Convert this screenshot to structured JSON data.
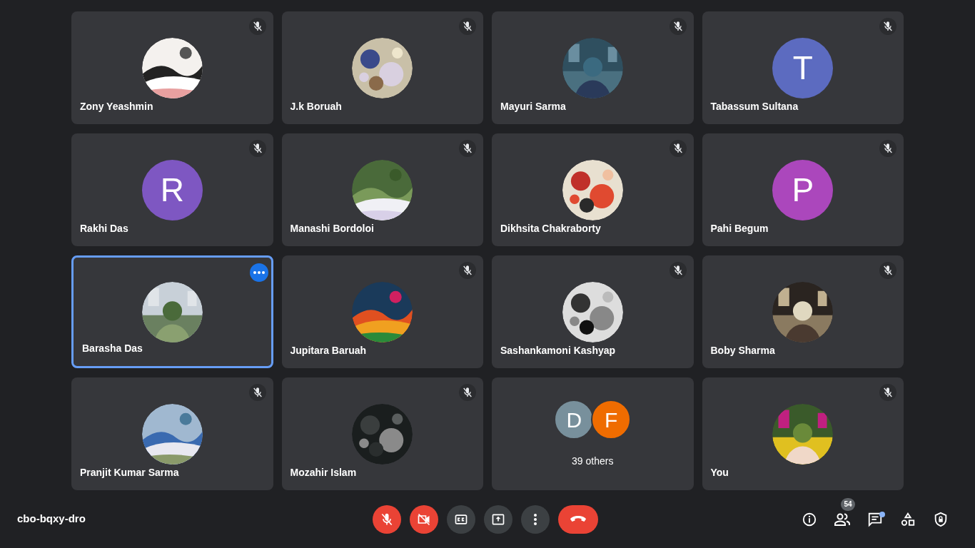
{
  "tiles": [
    {
      "kind": "picture",
      "name": "Zony Yeashmin",
      "muted": true,
      "selected": false
    },
    {
      "kind": "picture",
      "name": "J.k Boruah",
      "muted": true,
      "selected": false
    },
    {
      "kind": "picture",
      "name": "Mayuri Sarma",
      "muted": true,
      "selected": false
    },
    {
      "kind": "letter",
      "letter": "T",
      "color": "#5c6bc0",
      "name": "Tabassum Sultana",
      "muted": true,
      "selected": false
    },
    {
      "kind": "letter",
      "letter": "R",
      "color": "#7e57c2",
      "name": "Rakhi Das",
      "muted": true,
      "selected": false
    },
    {
      "kind": "picture",
      "name": "Manashi Bordoloi",
      "muted": true,
      "selected": false
    },
    {
      "kind": "picture",
      "name": "Dikhsita Chakraborty",
      "muted": true,
      "selected": false
    },
    {
      "kind": "letter",
      "letter": "P",
      "color": "#ab47bc",
      "name": "Pahi Begum",
      "muted": true,
      "selected": false
    },
    {
      "kind": "picture",
      "name": "Barasha Das",
      "selected": true
    },
    {
      "kind": "picture",
      "name": "Jupitara Baruah",
      "muted": true,
      "selected": false
    },
    {
      "kind": "picture",
      "name": "Sashankamoni Kashyap",
      "muted": true,
      "selected": false
    },
    {
      "kind": "picture",
      "name": "Boby Sharma",
      "muted": true,
      "selected": false
    },
    {
      "kind": "picture",
      "name": "Pranjit Kumar Sarma",
      "muted": true,
      "selected": false
    },
    {
      "kind": "picture",
      "name": "Mozahir Islam",
      "muted": true,
      "selected": false
    },
    {
      "kind": "others",
      "avatars": [
        {
          "letter": "D",
          "color": "#78909c"
        },
        {
          "letter": "F",
          "color": "#ef6c00"
        }
      ],
      "label": "39 others"
    },
    {
      "kind": "picture",
      "name": "You",
      "muted": true,
      "selected": false
    }
  ],
  "meeting_code": "cbo-bqxy-dro",
  "controls": [
    {
      "kind": "mic",
      "on": false
    },
    {
      "kind": "camera",
      "on": false
    },
    {
      "kind": "captions",
      "on": false
    },
    {
      "kind": "present",
      "on": false
    },
    {
      "kind": "more",
      "on": false
    },
    {
      "kind": "end_call",
      "on": false
    }
  ],
  "side_buttons": [
    {
      "kind": "info"
    },
    {
      "kind": "people",
      "badge": "54"
    },
    {
      "kind": "chat",
      "unread": true
    },
    {
      "kind": "activities"
    },
    {
      "kind": "host_controls"
    }
  ]
}
